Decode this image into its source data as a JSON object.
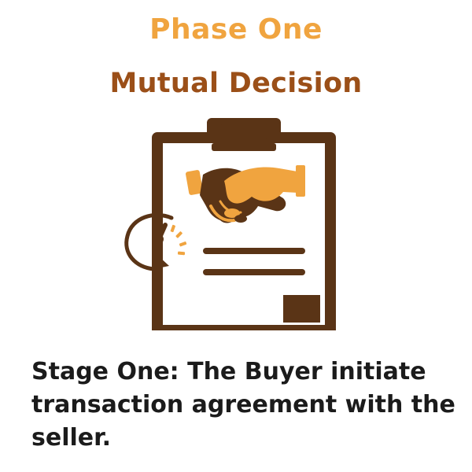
{
  "header": {
    "title": "Phase One",
    "subtitle": "Mutual Decision"
  },
  "illustration": {
    "icon": "clipboard-handshake-timer-icon",
    "colors": {
      "brown": "#5a3416",
      "orange": "#f0a43f"
    }
  },
  "body": {
    "text": "Stage One: The Buyer initiate transaction agreement with the seller."
  },
  "colors": {
    "title": "#f0a43f",
    "subtitle": "#9b4f18",
    "text": "#1b1b1b"
  }
}
